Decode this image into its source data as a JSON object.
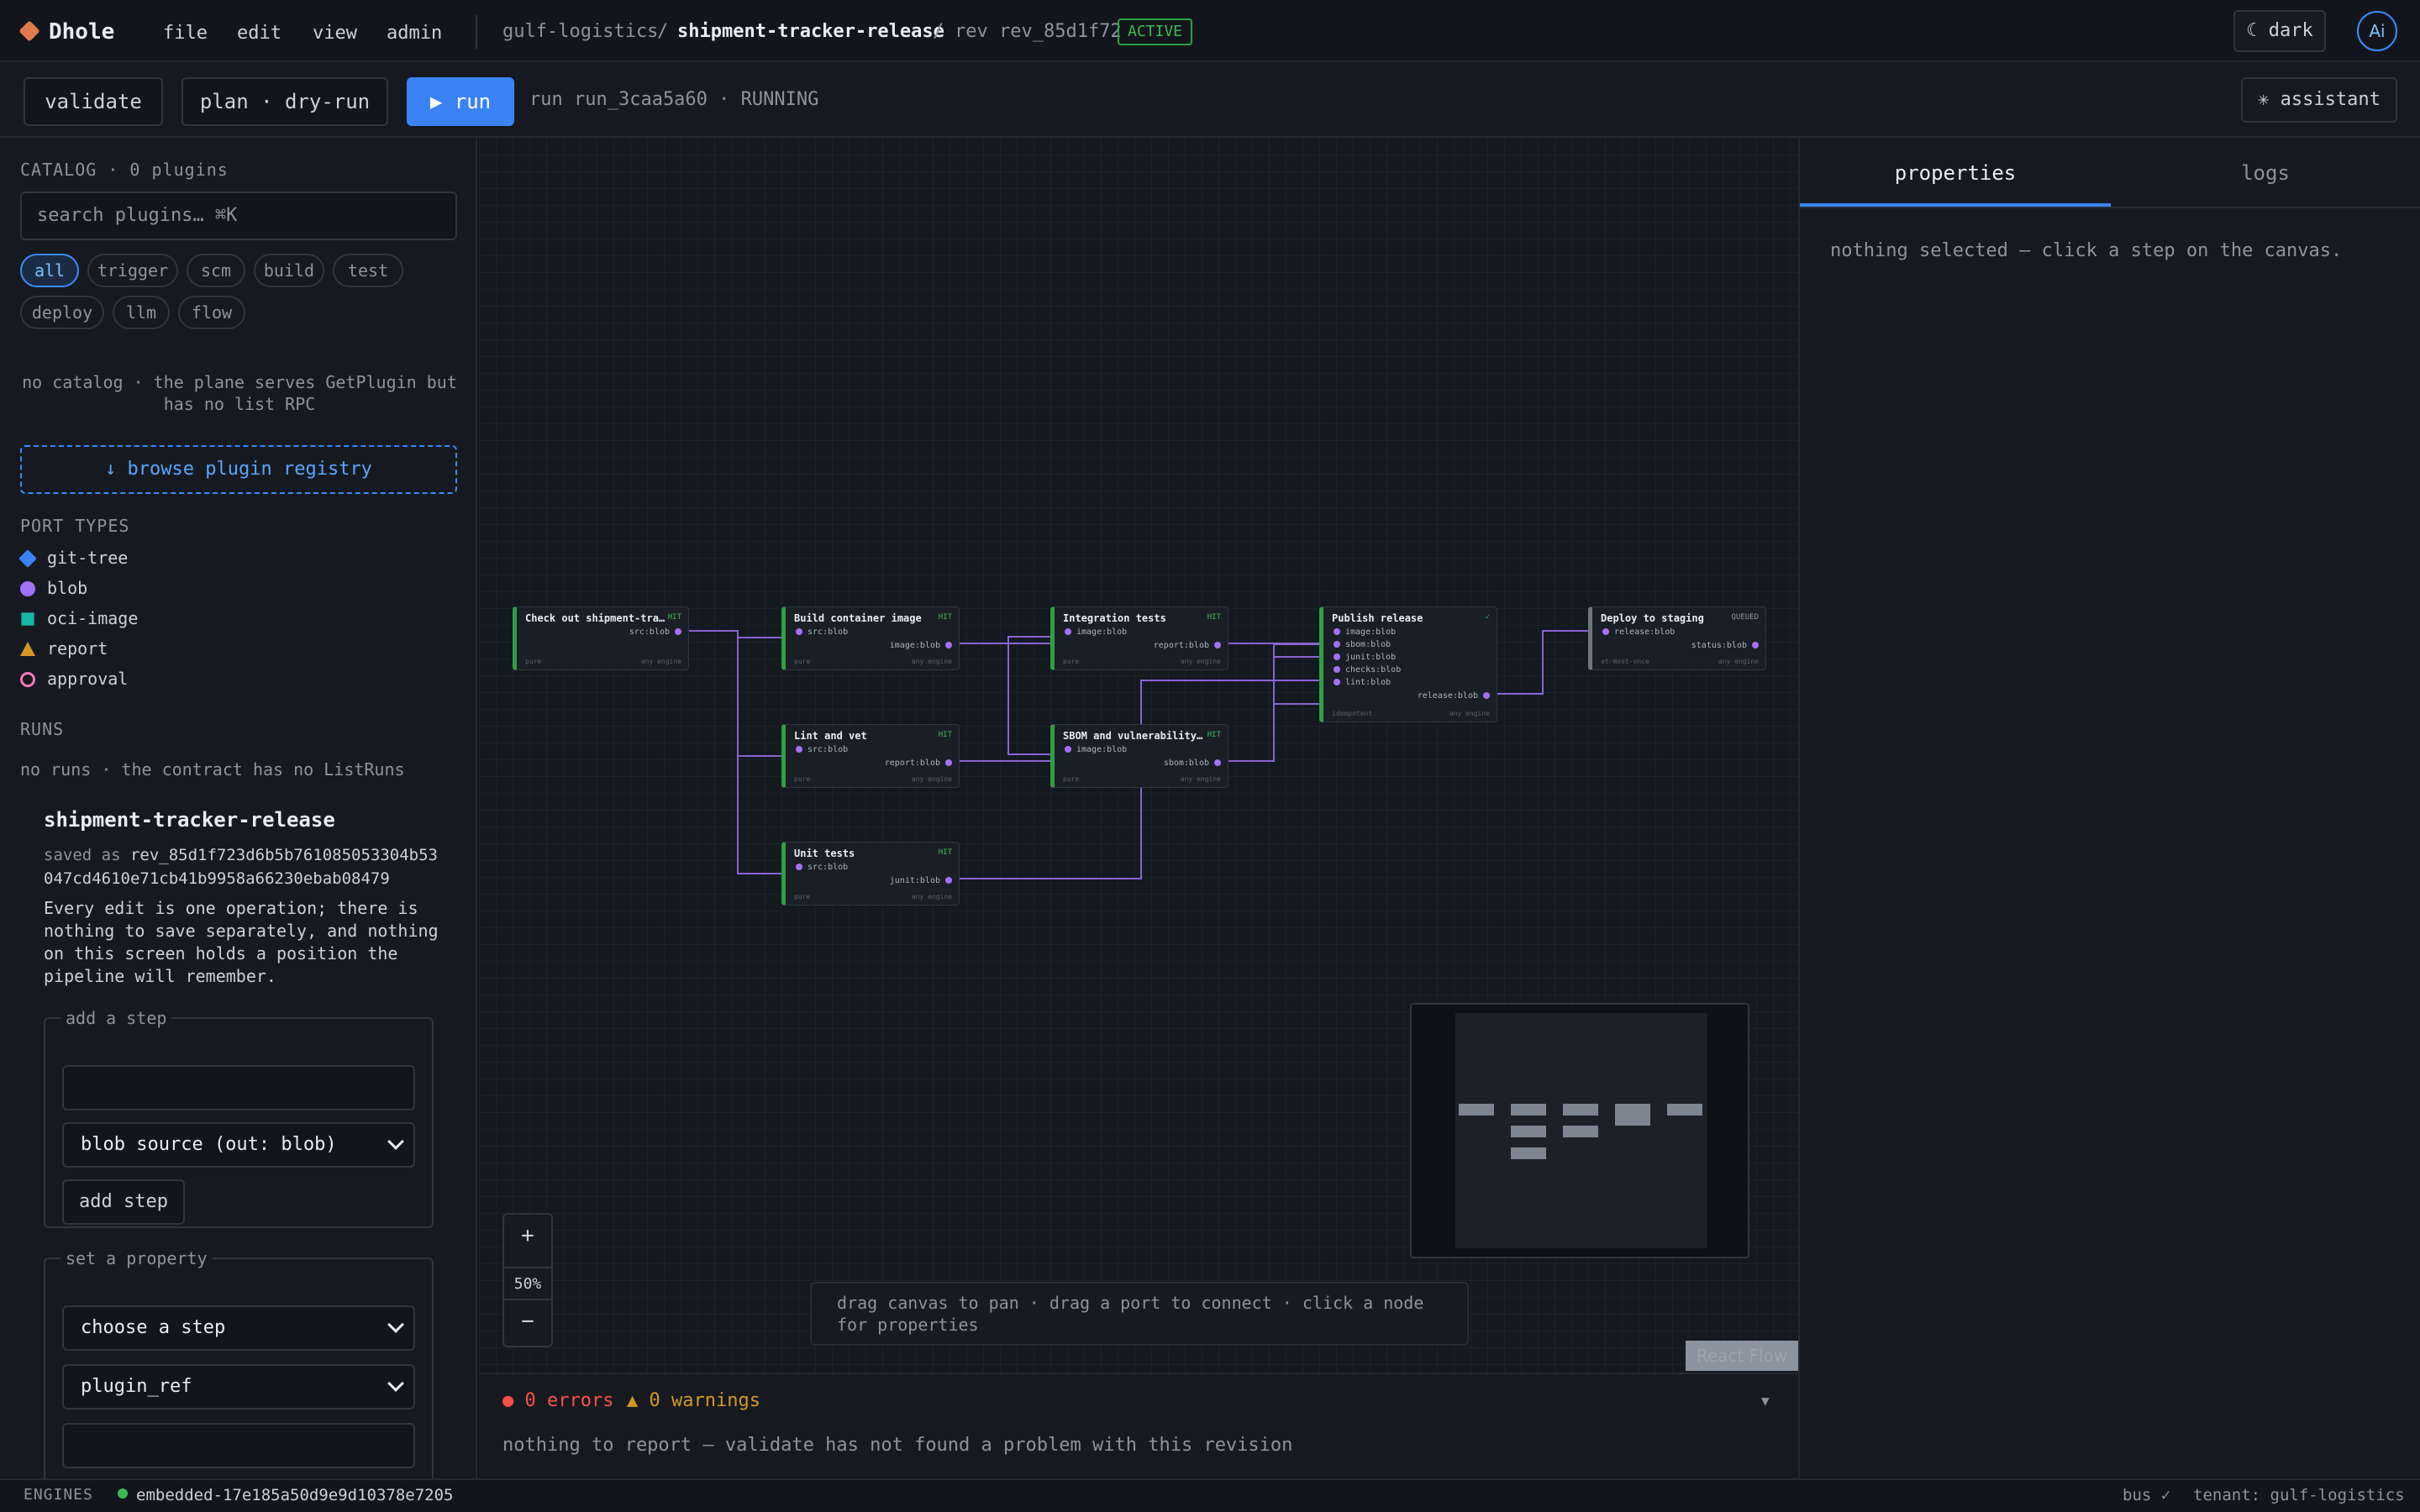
{
  "app": {
    "brand": "Dhole",
    "accent": "#3b82f6",
    "brand_color": "#e07b4c"
  },
  "menu": {
    "file": "file",
    "edit": "edit",
    "view": "view",
    "admin": "admin"
  },
  "breadcrumb": {
    "tenant": "gulf-logistics",
    "sep1": "/",
    "pipeline": "shipment-tracker-release",
    "sep2": "/",
    "rev": "rev rev_85d1f72",
    "badge": "ACTIVE"
  },
  "header": {
    "theme_label": "☾ dark",
    "avatar": "Ai"
  },
  "toolbar": {
    "validate": "validate",
    "plan": "plan · dry-run",
    "run": "▶ run",
    "status": "run run_3caa5a60 · RUNNING",
    "assistant": "✳ assistant"
  },
  "sidebar": {
    "catalog_title": "CATALOG · 0 plugins",
    "search_placeholder": "search plugins…  ⌘K",
    "chips": [
      "all",
      "trigger",
      "scm",
      "build",
      "test",
      "deploy",
      "llm",
      "flow"
    ],
    "no_catalog": "no catalog · the plane serves GetPlugin but has no list RPC",
    "browse": "↓ browse plugin registry",
    "port_types_title": "PORT TYPES",
    "port_types": [
      {
        "label": "git-tree",
        "icon": "diamond-icon",
        "color": "#3b82f6"
      },
      {
        "label": "blob",
        "icon": "circle-icon",
        "color": "#a371f7"
      },
      {
        "label": "oci-image",
        "icon": "square-icon",
        "color": "#14b8a6"
      },
      {
        "label": "report",
        "icon": "triangle-icon",
        "color": "#d29922"
      },
      {
        "label": "approval",
        "icon": "ring-icon",
        "color": "#f778ba"
      }
    ],
    "runs_title": "RUNS",
    "runs_empty": "no runs · the contract has no ListRuns",
    "pipeline_name": "shipment-tracker-release",
    "saved_prefix": "saved as ",
    "saved_rev": "rev_85d1f723d6b5b761085053304b53047cd4610e71cb41b9958a66230ebab08479",
    "edit_note": "Every edit is one operation; there is nothing to save separately, and nothing on this screen holds a position the pipeline will remember.",
    "add_step": {
      "legend": "add a step",
      "name_value": "",
      "kind": "blob source (out: blob)",
      "button": "add step"
    },
    "set_property": {
      "legend": "set a property",
      "step": "choose a step",
      "prop": "plugin_ref",
      "value": ""
    }
  },
  "canvas": {
    "nodes": [
      {
        "title": "Check out shipment-track…",
        "status": "HIT",
        "ins": [],
        "outs": [
          "src:blob"
        ],
        "fl": "pure",
        "fr": "any engine"
      },
      {
        "title": "Build container image",
        "status": "HIT",
        "ins": [
          "src:blob"
        ],
        "outs": [
          "image:blob"
        ],
        "fl": "pure",
        "fr": "any engine"
      },
      {
        "title": "Integration tests",
        "status": "HIT",
        "ins": [
          "image:blob"
        ],
        "outs": [
          "report:blob"
        ],
        "fl": "pure",
        "fr": "any engine"
      },
      {
        "title": "Publish release",
        "status": "✓",
        "ins": [
          "image:blob",
          "sbom:blob",
          "junit:blob",
          "checks:blob",
          "lint:blob"
        ],
        "outs": [
          "release:blob"
        ],
        "fl": "idempotent",
        "fr": "any engine"
      },
      {
        "title": "Deploy to staging",
        "status": "QUEUED",
        "ins": [
          "release:blob"
        ],
        "outs": [
          "status:blob"
        ],
        "fl": "at-most-once",
        "fr": "any engine"
      },
      {
        "title": "Lint and vet",
        "status": "HIT",
        "ins": [
          "src:blob"
        ],
        "outs": [
          "report:blob"
        ],
        "fl": "pure",
        "fr": "any engine"
      },
      {
        "title": "SBOM and vulnerability s…",
        "status": "HIT",
        "ins": [
          "image:blob"
        ],
        "outs": [
          "sbom:blob"
        ],
        "fl": "pure",
        "fr": "any engine"
      },
      {
        "title": "Unit tests",
        "status": "HIT",
        "ins": [
          "src:blob"
        ],
        "outs": [
          "junit:blob"
        ],
        "fl": "pure",
        "fr": "any engine"
      }
    ],
    "zoom_in": "+",
    "zoom_level": "50%",
    "zoom_out": "−",
    "hint": "drag canvas to pan · drag a port to connect · click a node for properties",
    "attribution": "React Flow"
  },
  "problems": {
    "errors": "● 0 errors",
    "warnings": "▲ 0 warnings",
    "collapse": "▼",
    "message": "nothing to report — validate has not found a problem with this revision"
  },
  "right_panel": {
    "tab_properties": "properties",
    "tab_logs": "logs",
    "empty": "nothing selected — click a step on the canvas."
  },
  "statusbar": {
    "engines_label": "ENGINES",
    "engine": "embedded-17e185a50d9e9d10378e7205",
    "bus": "bus ✓",
    "tenant": "tenant: gulf-logistics"
  }
}
